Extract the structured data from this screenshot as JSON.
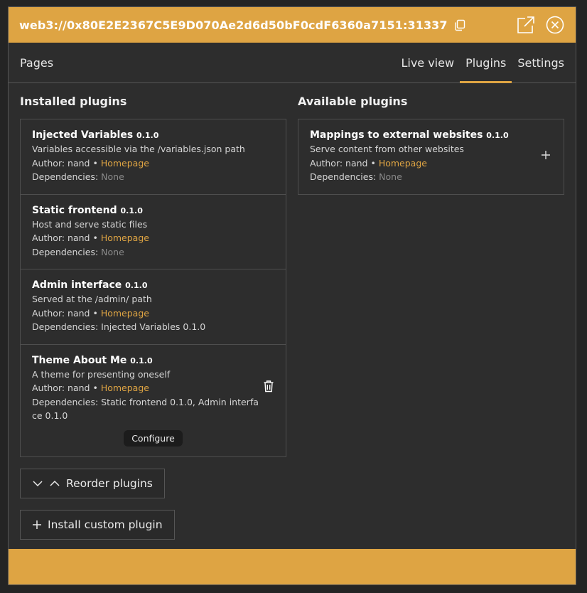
{
  "titlebar": {
    "address": "web3://0x80E2E2367C5E9D070Ae2d6d50bF0cdF6360a7151:31337"
  },
  "nav": {
    "pages_label": "Pages",
    "tabs": [
      {
        "label": "Live view",
        "active": false
      },
      {
        "label": "Plugins",
        "active": true
      },
      {
        "label": "Settings",
        "active": false
      }
    ]
  },
  "installed": {
    "heading": "Installed plugins",
    "plugins": [
      {
        "name": "Injected Variables",
        "version": "0.1.0",
        "description": "Variables accessible via the /variables.json path",
        "author_prefix": "Author: nand •",
        "homepage_label": "Homepage",
        "deps_label": "Dependencies:",
        "deps": "None"
      },
      {
        "name": "Static frontend",
        "version": "0.1.0",
        "description": "Host and serve static files",
        "author_prefix": "Author: nand •",
        "homepage_label": "Homepage",
        "deps_label": "Dependencies:",
        "deps": "None"
      },
      {
        "name": "Admin interface",
        "version": "0.1.0",
        "description": "Served at the /admin/ path",
        "author_prefix": "Author: nand •",
        "homepage_label": "Homepage",
        "deps_label": "Dependencies:",
        "deps": "Injected Variables 0.1.0"
      },
      {
        "name": "Theme About Me",
        "version": "0.1.0",
        "description": "A theme for presenting oneself",
        "author_prefix": "Author: nand •",
        "homepage_label": "Homepage",
        "deps_label": "Dependencies:",
        "deps": "Static frontend 0.1.0, Admin interface 0.1.0",
        "configure_label": "Configure"
      }
    ],
    "reorder_label": "Reorder plugins",
    "install_label": "Install custom plugin"
  },
  "available": {
    "heading": "Available plugins",
    "plugins": [
      {
        "name": "Mappings to external websites",
        "version": "0.1.0",
        "description": "Serve content from other websites",
        "author_prefix": "Author: nand •",
        "homepage_label": "Homepage",
        "deps_label": "Dependencies:",
        "deps": "None"
      }
    ]
  },
  "colors": {
    "accent": "#dea443",
    "background": "#2d2d2d"
  }
}
